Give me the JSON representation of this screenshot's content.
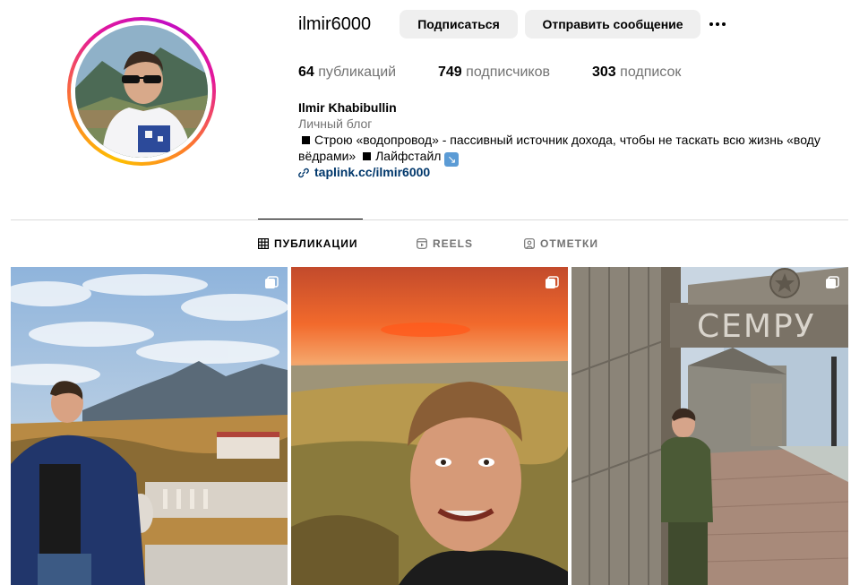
{
  "profile": {
    "username": "ilmir6000",
    "full_name": "Ilmir Khabibullin",
    "category": "Личный блог",
    "bio_part1": "Строю «водопровод» - пассивный источник дохода, чтобы не таскать всю жизнь «воду вёдрами»",
    "bio_part2": "Лайфстайл",
    "link": "taplink.cc/ilmir6000"
  },
  "actions": {
    "follow_label": "Подписаться",
    "message_label": "Отправить сообщение",
    "more_icon": "more-horizontal-icon"
  },
  "stats": {
    "posts_count": "64",
    "posts_label": "публикаций",
    "followers_count": "749",
    "followers_label": "подписчиков",
    "following_count": "303",
    "following_label": "подписок"
  },
  "tabs": [
    {
      "label": "ПУБЛИКАЦИИ",
      "icon": "grid-icon",
      "active": true
    },
    {
      "label": "REELS",
      "icon": "reels-icon",
      "active": false
    },
    {
      "label": "ОТМЕТКИ",
      "icon": "tagged-icon",
      "active": false
    }
  ],
  "posts": [
    {
      "kind": "carousel",
      "scene": "man in blue jacket at mountain viewpoint with cloudy sky"
    },
    {
      "kind": "carousel",
      "scene": "selfie at sunset over steppe hills"
    },
    {
      "kind": "carousel",
      "scene": "man in green outfit by wooden gate with sign"
    }
  ],
  "post3_sign_text": "СЕМРУ",
  "colors": {
    "link": "#00376b",
    "secondary_text": "#737373",
    "button_bg": "#efefef",
    "divider": "#dbdbdb"
  }
}
